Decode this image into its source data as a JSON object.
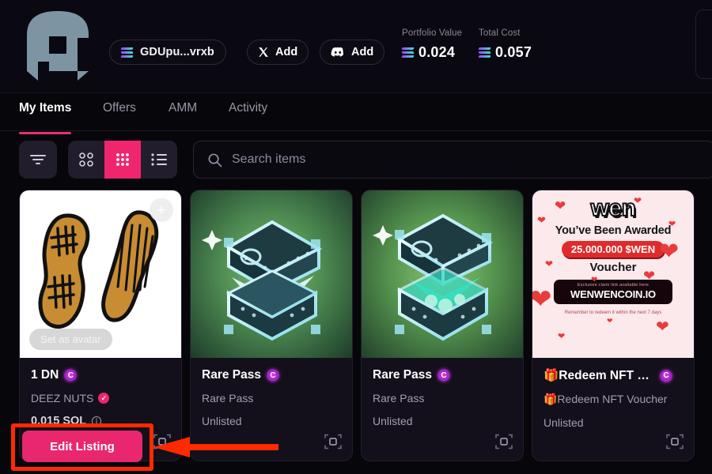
{
  "header": {
    "avatar_icon": "pixel-mushroom-avatar",
    "wallet": {
      "label": "GDUpu...vrxb",
      "icon": "solana-icon"
    },
    "socials": [
      {
        "name": "x",
        "icon": "x-twitter-icon",
        "label": "Add"
      },
      {
        "name": "discord",
        "icon": "discord-icon",
        "label": "Add"
      }
    ],
    "stats": [
      {
        "caption": "Portfolio Value",
        "value": "0.024",
        "icon": "solana-icon"
      },
      {
        "caption": "Total Cost",
        "value": "0.057",
        "icon": "solana-icon"
      }
    ]
  },
  "tabs": [
    {
      "label": "My Items",
      "active": true
    },
    {
      "label": "Offers",
      "active": false
    },
    {
      "label": "AMM",
      "active": false
    },
    {
      "label": "Activity",
      "active": false
    }
  ],
  "toolbar": {
    "filter_icon": "filter-icon",
    "views": [
      {
        "icon": "grid-2x2-icon",
        "active": false
      },
      {
        "icon": "grid-3x3-icon",
        "active": true
      },
      {
        "icon": "list-icon",
        "active": false
      }
    ],
    "search": {
      "placeholder": "Search items",
      "value": "",
      "icon": "search-icon"
    }
  },
  "cards": [
    {
      "title": "1 DN",
      "badge": "C",
      "collection": "DEEZ NUTS",
      "verified": true,
      "price": "0.015 SOL",
      "status": "",
      "overlay_button": "Set as avatar",
      "add_icon": "plus-icon",
      "expand_icon": "expand-icon",
      "art": "peanuts-artwork"
    },
    {
      "title": "Rare Pass",
      "badge": "C",
      "collection": "Rare Pass",
      "verified": false,
      "price": "",
      "status": "Unlisted",
      "expand_icon": "expand-icon",
      "art": "treasure-chest-artwork"
    },
    {
      "title": "Rare Pass",
      "badge": "C",
      "collection": "Rare Pass",
      "verified": false,
      "price": "",
      "status": "Unlisted",
      "expand_icon": "expand-icon",
      "art": "treasure-chest-artwork"
    },
    {
      "title": "🎁Redeem NFT V...",
      "badge": "C",
      "collection": "🎁Redeem NFT Voucher",
      "verified": false,
      "price": "",
      "status": "Unlisted",
      "expand_icon": "expand-icon",
      "art": "wen-voucher-artwork",
      "art_text": {
        "logo": "wen",
        "line1": "You’ve Been Awarded",
        "chip": "25.000.000 $WEN",
        "line2": "Voucher",
        "band_small": "Exclusive claim link available here",
        "band_url": "WENWENCOIN.IO",
        "footer": "Remember to redeem it within the next 7 days"
      }
    }
  ],
  "annotation": {
    "edit_listing_label": "Edit Listing",
    "highlight_color": "#ff2a00",
    "button_color": "#e8276f"
  }
}
